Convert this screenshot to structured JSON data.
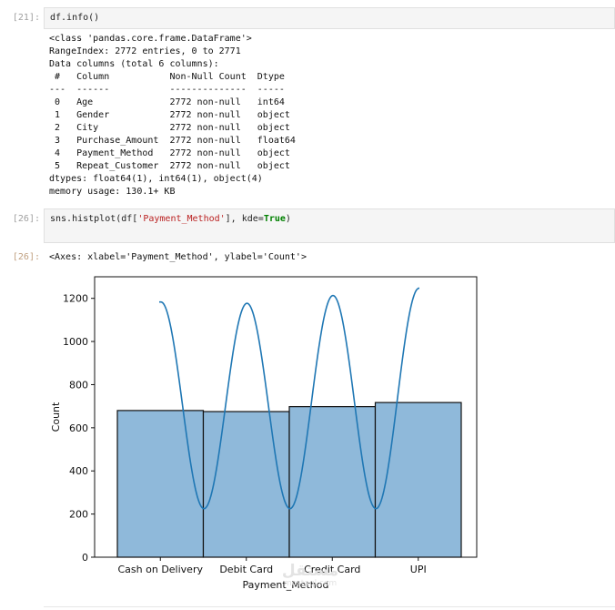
{
  "cells": [
    {
      "in_prompt": "[21]:",
      "code": {
        "fn": "df.info",
        "rest": "()"
      }
    },
    {
      "in_prompt": "[26]:",
      "code": {
        "fn": "sns.histplot(df[",
        "str": "'Payment_Method'",
        "mid": "], kde=",
        "bool": "True",
        "end": ")"
      }
    }
  ],
  "info_output": {
    "lines": [
      "<class 'pandas.core.frame.DataFrame'>",
      "RangeIndex: 2772 entries, 0 to 2771",
      "Data columns (total 6 columns):",
      " #   Column           Non-Null Count  Dtype  ",
      "---  ------           --------------  -----  ",
      " 0   Age              2772 non-null   int64  ",
      " 1   Gender           2772 non-null   object ",
      " 2   City             2772 non-null   object ",
      " 3   Purchase_Amount  2772 non-null   float64",
      " 4   Payment_Method   2772 non-null   object ",
      " 5   Repeat_Customer  2772 non-null   object ",
      "dtypes: float64(1), int64(1), object(4)",
      "memory usage: 130.1+ KB"
    ]
  },
  "out_prompt": "[26]:",
  "axes_repr": "<Axes: xlabel='Payment_Method', ylabel='Count'>",
  "watermark": {
    "logo": "مستقل",
    "url": "mostaql.com"
  },
  "chart_data": {
    "type": "bar",
    "title": "",
    "xlabel": "Payment_Method",
    "ylabel": "Count",
    "categories": [
      "Cash on Delivery",
      "Debit Card",
      "Credit Card",
      "UPI"
    ],
    "values": [
      680,
      675,
      698,
      717
    ],
    "kde_peaks": [
      1183,
      1177,
      1213,
      1247
    ],
    "kde_trough": 225,
    "ylim": [
      0,
      1300
    ],
    "yticks": [
      0,
      200,
      400,
      600,
      800,
      1000,
      1200
    ],
    "bar_color": "#8fb9da",
    "kde_color": "#1f77b4",
    "grid": false,
    "legend": "none"
  }
}
